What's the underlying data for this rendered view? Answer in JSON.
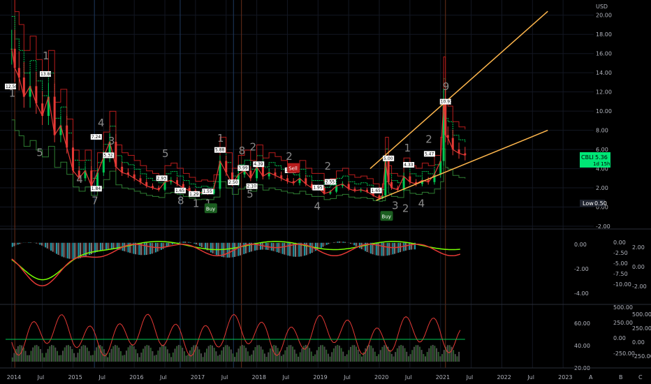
{
  "currency": "USD",
  "colors": {
    "up": "#00c853",
    "down": "#e53935",
    "trend": "#ffb74d",
    "teal": "#26c6da",
    "lime": "#76ff03",
    "pink": "#ff4081"
  },
  "chart_data": [
    {
      "type": "line",
      "panel": "price",
      "y_ticks": [
        "20.00",
        "18.00",
        "16.00",
        "14.00",
        "12.00",
        "10.00",
        "8.00",
        "6.00",
        "4.00",
        "2.00",
        "0.00",
        "-2.00"
      ],
      "ylim": [
        -2,
        21
      ],
      "x_labels": [
        "2014",
        "Jul",
        "2015",
        "Jul",
        "2016",
        "Jul",
        "2017",
        "Jul",
        "2018",
        "Jul",
        "2019",
        "Jul",
        "2020",
        "Jul",
        "2021",
        "Jul",
        "2022",
        "Jul",
        "2023"
      ],
      "xlim": [
        2013.9,
        2023.5
      ],
      "series": [
        {
          "points": [
            [
              2014.0,
              16.5
            ],
            [
              2014.05,
              14.5
            ],
            [
              2014.12,
              13.5
            ],
            [
              2014.2,
              11.5
            ],
            [
              2014.3,
              12.6
            ],
            [
              2014.4,
              10.8
            ],
            [
              2014.5,
              9.5
            ],
            [
              2014.6,
              11.5
            ],
            [
              2014.7,
              7.5
            ],
            [
              2014.8,
              8.5
            ],
            [
              2014.9,
              6.2
            ],
            [
              2015.0,
              3.8
            ],
            [
              2015.1,
              3.0
            ],
            [
              2015.2,
              3.8
            ],
            [
              2015.3,
              2.2
            ],
            [
              2015.4,
              3.6
            ],
            [
              2015.5,
              5.2
            ],
            [
              2015.6,
              6.8
            ],
            [
              2015.7,
              4.2
            ],
            [
              2015.8,
              3.6
            ],
            [
              2015.9,
              3.4
            ],
            [
              2016.0,
              3.0
            ],
            [
              2016.1,
              2.6
            ],
            [
              2016.2,
              2.2
            ],
            [
              2016.3,
              2.0
            ],
            [
              2016.4,
              1.8
            ],
            [
              2016.5,
              2.6
            ],
            [
              2016.6,
              2.8
            ],
            [
              2016.7,
              2.4
            ],
            [
              2016.8,
              2.0
            ],
            [
              2016.9,
              1.7
            ],
            [
              2017.0,
              1.4
            ],
            [
              2017.1,
              1.5
            ],
            [
              2017.2,
              1.4
            ],
            [
              2017.3,
              1.9
            ],
            [
              2017.4,
              4.8
            ],
            [
              2017.5,
              3.6
            ],
            [
              2017.6,
              2.4
            ],
            [
              2017.7,
              3.4
            ],
            [
              2017.8,
              3.8
            ],
            [
              2017.9,
              3.0
            ],
            [
              2018.0,
              4.2
            ],
            [
              2018.1,
              3.2
            ],
            [
              2018.2,
              3.6
            ],
            [
              2018.3,
              3.3
            ],
            [
              2018.4,
              3.0
            ],
            [
              2018.5,
              2.7
            ],
            [
              2018.6,
              2.5
            ],
            [
              2018.7,
              3.0
            ],
            [
              2018.8,
              2.4
            ],
            [
              2018.9,
              2.0
            ],
            [
              2019.0,
              2.0
            ],
            [
              2019.1,
              1.4
            ],
            [
              2019.2,
              1.6
            ],
            [
              2019.3,
              2.2
            ],
            [
              2019.4,
              2.4
            ],
            [
              2019.5,
              1.9
            ],
            [
              2019.6,
              1.7
            ],
            [
              2019.7,
              1.8
            ],
            [
              2019.8,
              1.6
            ],
            [
              2019.9,
              1.2
            ],
            [
              2020.0,
              0.9
            ],
            [
              2020.05,
              1.2
            ],
            [
              2020.1,
              4.8
            ],
            [
              2020.15,
              2.6
            ],
            [
              2020.2,
              2.0
            ],
            [
              2020.3,
              1.8
            ],
            [
              2020.4,
              3.2
            ],
            [
              2020.5,
              2.6
            ],
            [
              2020.6,
              2.4
            ],
            [
              2020.7,
              2.8
            ],
            [
              2020.8,
              2.6
            ],
            [
              2020.9,
              3.4
            ],
            [
              2021.0,
              4.8
            ],
            [
              2021.05,
              11.0
            ],
            [
              2021.08,
              7.5
            ],
            [
              2021.12,
              7.2
            ],
            [
              2021.2,
              6.0
            ],
            [
              2021.3,
              5.6
            ],
            [
              2021.4,
              5.4
            ]
          ]
        }
      ],
      "annotations": [
        {
          "text": "12.50",
          "x": 2013.98,
          "y": 12.5
        },
        {
          "text": "13.80",
          "x": 2014.55,
          "y": 13.8
        },
        {
          "text": "7.24",
          "x": 2015.38,
          "y": 7.24
        },
        {
          "text": "5.32",
          "x": 2015.58,
          "y": 5.32
        },
        {
          "text": "2.93",
          "x": 2016.45,
          "y": 2.93
        },
        {
          "text": "1.65",
          "x": 2016.75,
          "y": 1.65
        },
        {
          "text": "1.29",
          "x": 2016.98,
          "y": 1.29
        },
        {
          "text": "1.55",
          "x": 2017.2,
          "y": 1.55
        },
        {
          "text": "5.88",
          "x": 2017.4,
          "y": 5.88
        },
        {
          "text": "2.50",
          "x": 2017.62,
          "y": 2.5
        },
        {
          "text": "3.99",
          "x": 2017.78,
          "y": 3.99
        },
        {
          "text": "2.10",
          "x": 2017.92,
          "y": 2.1
        },
        {
          "text": "4.39",
          "x": 2018.03,
          "y": 4.39
        },
        {
          "text": "3.76",
          "x": 2018.55,
          "y": 3.76
        },
        {
          "text": "1.95",
          "x": 2019.0,
          "y": 1.95
        },
        {
          "text": "2.55",
          "x": 2019.2,
          "y": 2.55
        },
        {
          "text": "1.65",
          "x": 2019.95,
          "y": 1.65
        },
        {
          "text": "5.00",
          "x": 2020.15,
          "y": 5.0
        },
        {
          "text": "4.33",
          "x": 2020.48,
          "y": 4.33
        },
        {
          "text": "5.47",
          "x": 2020.82,
          "y": 5.47
        },
        {
          "text": "10.91",
          "x": 2021.08,
          "y": 10.91
        },
        {
          "text": "1.84",
          "x": 2015.38,
          "y": 1.84
        }
      ],
      "count_labels": [
        {
          "text": "1",
          "x": 2014.0,
          "y": 11.5
        },
        {
          "text": "1",
          "x": 2014.55,
          "y": 15.4
        },
        {
          "text": "5",
          "x": 2014.45,
          "y": 5.3
        },
        {
          "text": "4",
          "x": 2015.1,
          "y": 2.5
        },
        {
          "text": "7",
          "x": 2015.35,
          "y": 0.3
        },
        {
          "text": "4",
          "x": 2015.45,
          "y": 8.4
        },
        {
          "text": "3",
          "x": 2015.62,
          "y": 6.5
        },
        {
          "text": "5",
          "x": 2016.5,
          "y": 5.2
        },
        {
          "text": "8",
          "x": 2016.75,
          "y": 0.3
        },
        {
          "text": "1",
          "x": 2017.4,
          "y": 6.8
        },
        {
          "text": "1",
          "x": 2017.0,
          "y": 0.0
        },
        {
          "text": "1",
          "x": 2017.2,
          "y": 0.0
        },
        {
          "text": "8",
          "x": 2017.75,
          "y": 5.5
        },
        {
          "text": "2",
          "x": 2017.93,
          "y": 5.9
        },
        {
          "text": "5",
          "x": 2017.88,
          "y": 1.0
        },
        {
          "text": "2",
          "x": 2018.52,
          "y": 4.9
        },
        {
          "text": "2",
          "x": 2019.15,
          "y": 3.9
        },
        {
          "text": "4",
          "x": 2018.98,
          "y": -0.3
        },
        {
          "text": "3",
          "x": 2020.25,
          "y": -0.2
        },
        {
          "text": "2",
          "x": 2020.42,
          "y": -0.5
        },
        {
          "text": "1",
          "x": 2020.45,
          "y": 5.8
        },
        {
          "text": "2",
          "x": 2020.8,
          "y": 6.7
        },
        {
          "text": "4",
          "x": 2020.68,
          "y": 0.0
        },
        {
          "text": "9",
          "x": 2021.08,
          "y": 12.2
        }
      ],
      "signals": [
        {
          "text": "Buy",
          "x": 2017.25,
          "y": -0.2,
          "kind": "buy"
        },
        {
          "text": "Sell",
          "x": 2018.6,
          "y": 4.0,
          "kind": "sell"
        },
        {
          "text": "Buy",
          "x": 2020.12,
          "y": -1.0,
          "kind": "buy"
        }
      ],
      "price_label": {
        "symbol": "CBLI",
        "value": "5.36",
        "timer": "1d 15h"
      },
      "low_label": {
        "text": "Low",
        "value": "0.50"
      }
    },
    {
      "type": "line",
      "panel": "oscillator",
      "y_ticks_left": [
        "0.00",
        "-2.00",
        "-4.00"
      ],
      "y_ticks_mid": [
        "0.00",
        "-2.50",
        "-5.00",
        "-7.50",
        "-10.00"
      ],
      "y_ticks_right": [
        "2.00",
        "0.00",
        "-2.00"
      ]
    },
    {
      "type": "bar",
      "panel": "volume",
      "y_ticks_left": [
        "60.00",
        "40.00",
        "20.00"
      ],
      "y_ticks_mid": [
        "500.00",
        "250.00",
        "0.00",
        "-250.00"
      ],
      "y_ticks_right": [
        "500.00",
        "250.00",
        "0.00",
        "-250.00"
      ]
    }
  ],
  "nav": {
    "a": "A",
    "b": "B",
    "c": "C"
  }
}
